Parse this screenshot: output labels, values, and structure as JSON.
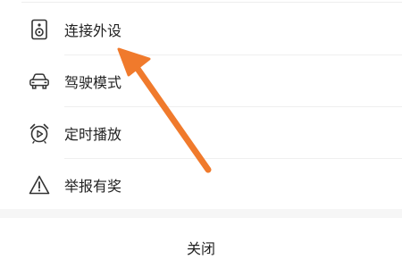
{
  "menu": {
    "items": [
      {
        "label": "连接外设",
        "icon": "speaker-icon"
      },
      {
        "label": "驾驶模式",
        "icon": "car-icon"
      },
      {
        "label": "定时播放",
        "icon": "alarm-clock-icon"
      },
      {
        "label": "举报有奖",
        "icon": "warning-icon"
      }
    ],
    "close_label": "关闭"
  },
  "colors": {
    "arrow": "#f07a2c",
    "icon": "#333333",
    "text": "#222222"
  }
}
